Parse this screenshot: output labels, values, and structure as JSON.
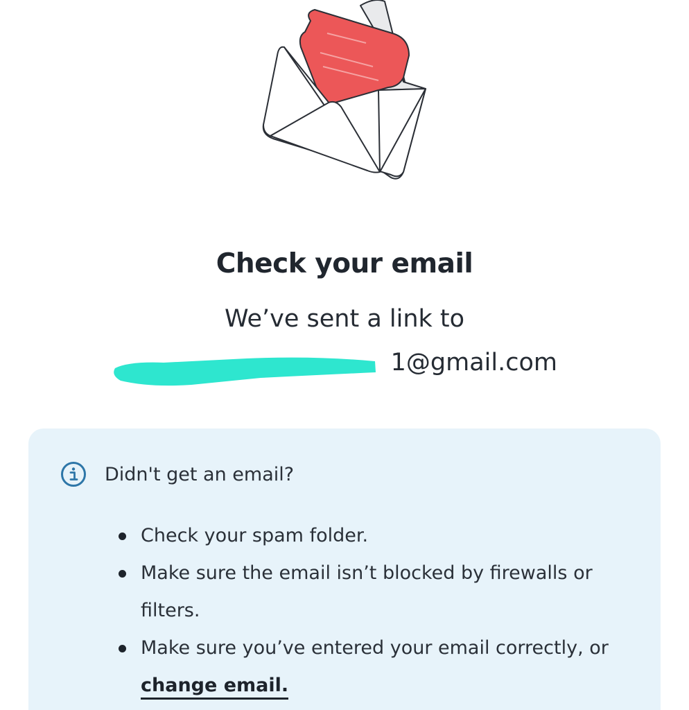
{
  "header": {
    "title": "Check your email",
    "sent_text": "We’ve sent a link to",
    "email_visible": "1@gmail.com"
  },
  "help": {
    "icon": "info-icon",
    "title": "Didn't get an email?",
    "bullets": [
      "Check your spam folder.",
      "Make sure the email isn’t blocked by firewalls or filters.",
      "Make sure you’ve entered your email correctly, or"
    ],
    "change_link_label": "change email."
  },
  "colors": {
    "envelope_letter": "#ec5758",
    "redaction": "#2ee6cf",
    "help_background": "#e7f3fa",
    "info_icon": "#2d76a8"
  }
}
